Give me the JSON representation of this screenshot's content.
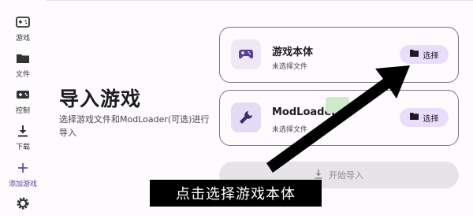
{
  "sidebar": {
    "items": [
      {
        "label": "游戏",
        "icon": "gamepad-icon"
      },
      {
        "label": "文件",
        "icon": "folder-icon"
      },
      {
        "label": "控制",
        "icon": "controller-icon"
      },
      {
        "label": "下载",
        "icon": "download-icon"
      },
      {
        "label": "添加游戏",
        "icon": "plus-icon"
      }
    ],
    "settings_icon": "gear-icon"
  },
  "main": {
    "heading": "导入游戏",
    "description": "选择游戏文件和ModLoader(可选)进行导入"
  },
  "cards": [
    {
      "title": "游戏本体",
      "subtitle": "未选择文件",
      "icon": "gamepad-icon",
      "button_label": "选择"
    },
    {
      "title": "ModLoader",
      "subtitle": "未选择文件",
      "icon": "wrench-icon",
      "button_label": "选择"
    }
  ],
  "start_button": {
    "label": "开始导入",
    "icon": "download-icon"
  },
  "overlay": {
    "caption": "点击选择游戏本体",
    "icon": "arrow-icon"
  },
  "colors": {
    "accent": "#5a3fa3",
    "button_bg": "#e8defb",
    "card_border": "#7a757f",
    "tag_green": "#cfeacb",
    "disabled_bg": "#e6e4e9"
  }
}
